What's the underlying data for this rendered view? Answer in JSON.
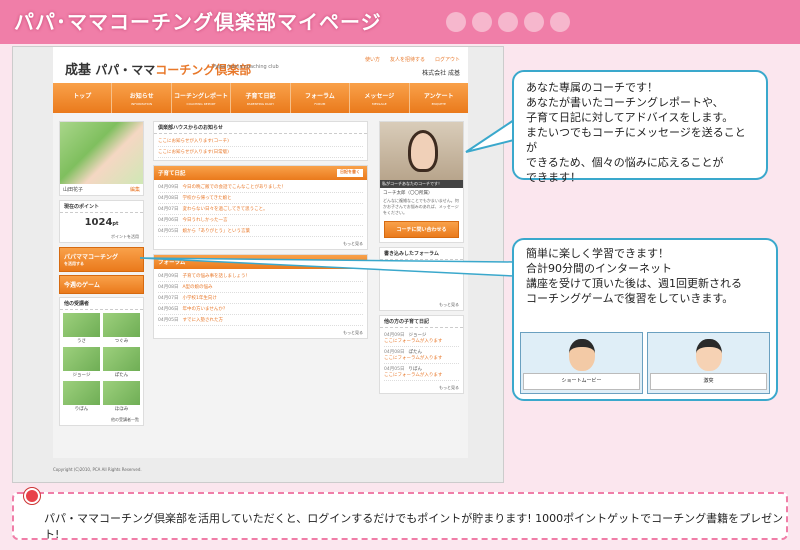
{
  "banner": {
    "title": "パパ･ママコーチング倶楽部マイページ"
  },
  "header": {
    "logo_main": "成基",
    "logo_prefix": "パパ・ママ",
    "logo_brand": "コーチング倶楽部",
    "logo_sub": "Papa mama coaching club",
    "links": [
      "使い方",
      "友人を招待する",
      "ログアウト"
    ],
    "company": "株式会社 成基"
  },
  "nav": {
    "items": [
      {
        "label": "トップ",
        "sub": ""
      },
      {
        "label": "お知らせ",
        "sub": "INFORMATION"
      },
      {
        "label": "コーチングレポート",
        "sub": "COACHING REPORT"
      },
      {
        "label": "子育て日記",
        "sub": "PARENTING DIARY"
      },
      {
        "label": "フォーラム",
        "sub": "FORUM"
      },
      {
        "label": "メッセージ",
        "sub": "MESSAGE"
      },
      {
        "label": "アンケート",
        "sub": "ENQUETE"
      }
    ]
  },
  "sidebar": {
    "user_name": "山田花子",
    "edit_label": "編集",
    "points_title": "現在のポイント",
    "points_value": "1024",
    "points_unit": "pt",
    "points_link": "ポイントを活用",
    "coaching_button": "パパママコーチング",
    "coaching_sub": "を活用する",
    "game_button": "今週のゲーム",
    "friends_title": "他の受講者",
    "friends": [
      "うさ",
      "つぐみ",
      "ジョージ",
      "ぽたん",
      "りぼん",
      "ほほみ"
    ],
    "friends_more": "他の受講者一覧"
  },
  "center": {
    "news_title": "倶楽部ハウスからのお知らせ",
    "news": [
      "ここにお知らせが入ります(コーチ)",
      "ここにお知らせが入ります(日常版)"
    ],
    "diary_title": "子育て日記",
    "diary_button": "日記を書く",
    "diary": [
      {
        "date": "04月09日",
        "text": "今日の晩ご飯での会話でこんなことがありました！"
      },
      {
        "date": "04月08日",
        "text": "学校から帰ってきた娘と"
      },
      {
        "date": "04月07日",
        "text": "変わらない日々を過ごしてきて思うこと。"
      },
      {
        "date": "04月06日",
        "text": "今日うれしかった一言"
      },
      {
        "date": "04月05日",
        "text": "娘から「ありがとう」という言葉"
      }
    ],
    "forum_title": "フォーラム",
    "forum": [
      {
        "date": "04月09日",
        "text": "子育ての悩み事を話しましょう！"
      },
      {
        "date": "04月08日",
        "text": "A型の娘の悩み"
      },
      {
        "date": "04月07日",
        "text": "小学校1年生向け"
      },
      {
        "date": "04月06日",
        "text": "年中の方いませんか？"
      },
      {
        "date": "04月05日",
        "text": "すでに入塾された方"
      }
    ],
    "more": "もっと見る"
  },
  "right": {
    "coach_caption": "私がコーチあなたのコーチです！",
    "coach_name": "コーチ太郎（〇〇所属）",
    "coach_desc": "どんなに複雑なことでもかまいません。何かお子さんでお悩みのあれば、メッセージをください。",
    "coach_button": "コーチに問い合わせる",
    "forum_written_title": "書き込みしたフォーラム",
    "others_diary_title": "他の方の子育て日記",
    "others_diary": [
      {
        "date": "04月09日",
        "name": "ジョージ",
        "text": "ここにフォーラムが入ります"
      },
      {
        "date": "04月08日",
        "name": "ぽたん",
        "text": "ここにフォーラムが入ります"
      },
      {
        "date": "04月05日",
        "name": "りぼん",
        "text": "ここにフォーラムが入ります"
      }
    ],
    "more": "もっと見る"
  },
  "footer": {
    "copyright": "Copyright (C)2010, PCA All Rights Reserved."
  },
  "callout1": {
    "lines": [
      "あなた専属のコーチです！",
      "あなたが書いたコーチングレポートや、",
      "子育て日記に対してアドバイスをします。",
      "またいつでもコーチにメッセージを送ることが",
      "できるため、個々の悩みに応えることが",
      "できます！"
    ]
  },
  "callout2": {
    "lines": [
      "簡単に楽しく学習できます！",
      "合計90分間のインターネット",
      "講座を受けて頂いた後は、週1回更新される",
      "コーチングゲームで復習をしていきます。"
    ],
    "shot_labels": [
      "ショートムービー",
      "激突"
    ]
  },
  "bottom": {
    "text": "パパ・ママコーチング倶楽部を活用していただくと、ログインするだけでもポイントが貯まります! 1000ポイントゲットでコーチング書籍をプレゼント!"
  },
  "colors": {
    "pink": "#f07ea8",
    "orange": "#ea7a1c",
    "blue": "#3aa8cc"
  }
}
